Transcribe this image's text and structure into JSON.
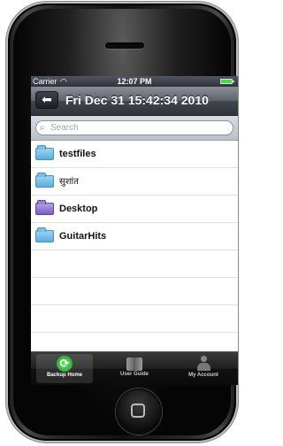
{
  "status_bar": {
    "carrier": "Carrier",
    "wifi_icon": "wifi-icon",
    "time": "12:07 PM",
    "battery_icon": "battery-icon"
  },
  "nav_bar": {
    "back_icon": "back-arrow-icon",
    "title": "Fri Dec 31 15:42:34 2010"
  },
  "search": {
    "placeholder": "Search"
  },
  "files": [
    {
      "name": "testfiles",
      "icon": "folder-icon"
    },
    {
      "name": "सुशांत",
      "icon": "folder-icon"
    },
    {
      "name": "Desktop",
      "icon": "desktop-folder-icon"
    },
    {
      "name": "GuitarHits",
      "icon": "folder-icon"
    }
  ],
  "tabs": [
    {
      "label": "Backup Home",
      "icon": "refresh-icon",
      "active": true
    },
    {
      "label": "User Guide",
      "icon": "book-icon",
      "active": false
    },
    {
      "label": "My Account",
      "icon": "person-icon",
      "active": false
    }
  ]
}
